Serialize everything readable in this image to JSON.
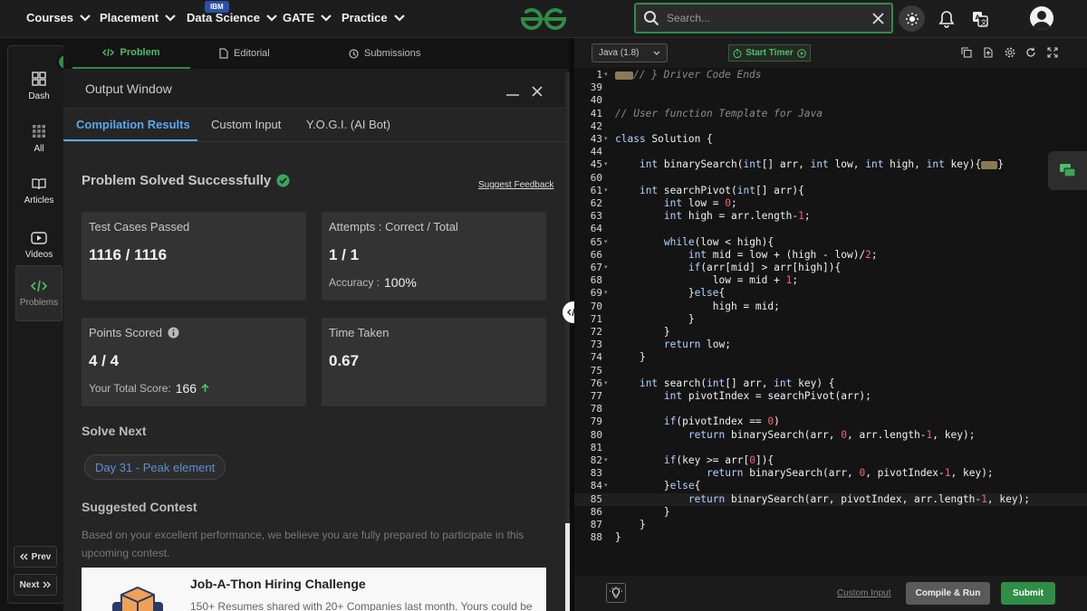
{
  "nav": {
    "items": [
      {
        "label": "Courses"
      },
      {
        "label": "Placement"
      },
      {
        "label": "Data Science"
      },
      {
        "label": "GATE"
      },
      {
        "label": "Practice"
      }
    ],
    "ibm_badge": "IBM",
    "search_placeholder": "Search...",
    "colors": {
      "brand": "#2f8d46",
      "accent": "#5aa9ef"
    }
  },
  "sidebar": {
    "items": [
      {
        "label": "Dash",
        "icon": "dashboard-icon"
      },
      {
        "label": "All",
        "icon": "grid-icon"
      },
      {
        "label": "Articles",
        "icon": "book-icon"
      },
      {
        "label": "Videos",
        "icon": "video-icon"
      },
      {
        "label": "Problems",
        "icon": "code-icon"
      }
    ],
    "prev_label": "Prev",
    "next_label": "Next"
  },
  "problem_tabs": [
    {
      "label": "Problem"
    },
    {
      "label": "Editorial"
    },
    {
      "label": "Submissions"
    }
  ],
  "output_window": {
    "title": "Output Window",
    "tabs": [
      {
        "label": "Compilation Results"
      },
      {
        "label": "Custom Input"
      },
      {
        "label": "Y.O.G.I. (AI Bot)"
      }
    ],
    "status": "Problem Solved Successfully",
    "suggest_feedback": "Suggest Feedback",
    "cards": {
      "test_cases": {
        "label": "Test Cases Passed",
        "value": "1116 / 1116"
      },
      "attempts": {
        "label": "Attempts : Correct / Total",
        "value": "1 / 1",
        "accuracy_label": "Accuracy :",
        "accuracy_value": "100%"
      },
      "points": {
        "label": "Points Scored",
        "value": "4 / 4",
        "total_label": "Your Total Score:",
        "total_value": "166"
      },
      "time": {
        "label": "Time Taken",
        "value": "0.67"
      }
    },
    "solve_next_heading": "Solve Next",
    "solve_next_item": "Day 31 - Peak element",
    "suggested_contest_heading": "Suggested Contest",
    "contest_text": "Based on your excellent performance, we believe you are fully prepared to participate in this upcoming contest.",
    "banner_title": "Job-A-Thon Hiring Challenge",
    "banner_desc": "150+ Resumes shared with 20+ Companies last month. Yours could be"
  },
  "editor": {
    "language": "Java (1.8)",
    "timer_label": "Start Timer",
    "lines": [
      {
        "n": "1",
        "code": "// } Driver Code Ends"
      },
      {
        "n": "39",
        "code": ""
      },
      {
        "n": "40",
        "code": ""
      },
      {
        "n": "41",
        "code": "// User function Template for Java"
      },
      {
        "n": "42",
        "code": ""
      },
      {
        "n": "43",
        "code": "class Solution {"
      },
      {
        "n": "44",
        "code": ""
      },
      {
        "n": "45",
        "code": "    int binarySearch(int[] arr, int low, int high, int key){"
      },
      {
        "n": "60",
        "code": ""
      },
      {
        "n": "61",
        "code": "    int searchPivot(int[] arr){"
      },
      {
        "n": "62",
        "code": "        int low = 0;"
      },
      {
        "n": "63",
        "code": "        int high = arr.length-1;"
      },
      {
        "n": "64",
        "code": ""
      },
      {
        "n": "65",
        "code": "        while(low < high){"
      },
      {
        "n": "66",
        "code": "            int mid = low + (high - low)/2;"
      },
      {
        "n": "67",
        "code": "            if(arr[mid] > arr[high]){"
      },
      {
        "n": "68",
        "code": "                low = mid + 1;"
      },
      {
        "n": "69",
        "code": "            }else{"
      },
      {
        "n": "70",
        "code": "                high = mid;"
      },
      {
        "n": "71",
        "code": "            }"
      },
      {
        "n": "72",
        "code": "        }"
      },
      {
        "n": "73",
        "code": "        return low;"
      },
      {
        "n": "74",
        "code": "    }"
      },
      {
        "n": "75",
        "code": ""
      },
      {
        "n": "76",
        "code": "    int search(int[] arr, int key) {"
      },
      {
        "n": "77",
        "code": "        int pivotIndex = searchPivot(arr);"
      },
      {
        "n": "78",
        "code": ""
      },
      {
        "n": "79",
        "code": "        if(pivotIndex == 0)"
      },
      {
        "n": "80",
        "code": "            return binarySearch(arr, 0, arr.length-1, key);"
      },
      {
        "n": "81",
        "code": ""
      },
      {
        "n": "82",
        "code": "        if(key >= arr[0]){"
      },
      {
        "n": "83",
        "code": "               return binarySearch(arr, 0, pivotIndex-1, key);"
      },
      {
        "n": "84",
        "code": "        }else{"
      },
      {
        "n": "85",
        "code": "            return binarySearch(arr, pivotIndex, arr.length-1, key);"
      },
      {
        "n": "86",
        "code": "        }"
      },
      {
        "n": "87",
        "code": "    }"
      },
      {
        "n": "88",
        "code": "}"
      }
    ],
    "highlighted_line": "85"
  },
  "bottom": {
    "custom_input": "Custom Input",
    "compile_run": "Compile & Run",
    "submit": "Submit"
  }
}
